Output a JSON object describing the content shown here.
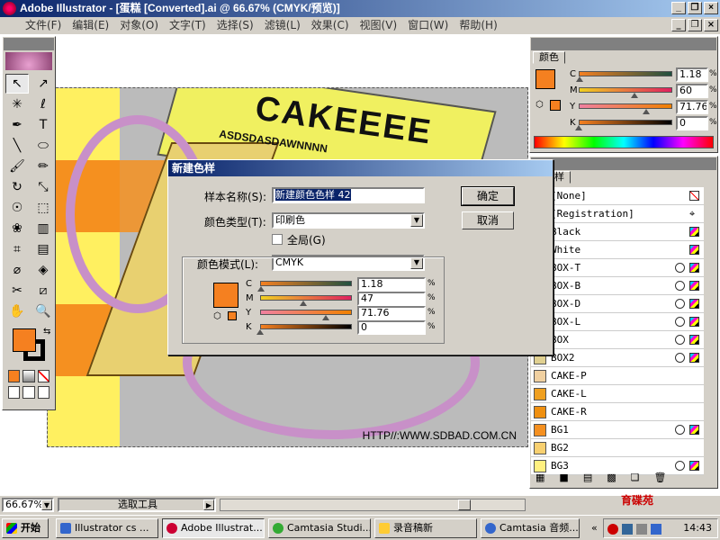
{
  "window": {
    "title": "Adobe Illustrator - [蛋糕 [Converted].ai @ 66.67% (CMYK/预览)]"
  },
  "menu": [
    "文件(F)",
    "编辑(E)",
    "对象(O)",
    "文字(T)",
    "选择(S)",
    "滤镜(L)",
    "效果(C)",
    "视图(V)",
    "窗口(W)",
    "帮助(H)"
  ],
  "winbtns": [
    "_",
    "❐",
    "×"
  ],
  "mdibtns": [
    "_",
    "❐",
    "×"
  ],
  "canvas": {
    "headline": "CAKEEEE",
    "subline": "ASDSDASDAWNNNN",
    "url": "HTTP//:WWW.SDBAD.COM.CN"
  },
  "dialog": {
    "title": "新建色样",
    "name_label": "样本名称(S):",
    "name_value": "新建颜色色样 42",
    "type_label": "颜色类型(T):",
    "type_value": "印刷色",
    "global_label": "全局(G)",
    "mode_label": "颜色模式(L):",
    "mode_value": "CMYK",
    "ok": "确定",
    "cancel": "取消",
    "channels": [
      {
        "label": "C",
        "value": "1.18",
        "pct": 1.18
      },
      {
        "label": "M",
        "value": "47",
        "pct": 47
      },
      {
        "label": "Y",
        "value": "71.76",
        "pct": 71.76
      },
      {
        "label": "K",
        "value": "0",
        "pct": 0
      }
    ],
    "unit": "%"
  },
  "color_panel": {
    "tab": "颜色",
    "channels": [
      {
        "label": "C",
        "value": "1.18",
        "pct": 1.18
      },
      {
        "label": "M",
        "value": "60",
        "pct": 60
      },
      {
        "label": "Y",
        "value": "71.76",
        "pct": 71.76
      },
      {
        "label": "K",
        "value": "0",
        "pct": 0
      }
    ]
  },
  "swatch_panel": {
    "tab": "样",
    "swatches": [
      {
        "name": "[None]",
        "color": "#ffffff"
      },
      {
        "name": "[Registration]",
        "color": "#000000"
      },
      {
        "name": "Black",
        "color": "#000000"
      },
      {
        "name": "White",
        "color": "#ffffff"
      },
      {
        "name": "BOX-T",
        "color": "#f0f060"
      },
      {
        "name": "BOX-B",
        "color": "#c0a040"
      },
      {
        "name": "BOX-D",
        "color": "#806020"
      },
      {
        "name": "BOX-L",
        "color": "#e0c060"
      },
      {
        "name": "BOX",
        "color": "#f0e080"
      },
      {
        "name": "BOX2",
        "color": "#e0d090"
      },
      {
        "name": "CAKE-P",
        "color": "#f0d0a0"
      },
      {
        "name": "CAKE-L",
        "color": "#f0a020"
      },
      {
        "name": "CAKE-R",
        "color": "#f09010"
      },
      {
        "name": "BG1",
        "color": "#f59020"
      },
      {
        "name": "BG2",
        "color": "#f8d070"
      },
      {
        "name": "BG3",
        "color": "#fff080"
      }
    ]
  },
  "status": {
    "zoom": "66.67%",
    "tool": "选取工具"
  },
  "taskbar": {
    "start": "开始",
    "tasks": [
      "Illustrator cs ...",
      "Adobe Illustrat...",
      "Camtasia Studi...",
      "录音稿新",
      "Camtasia 音频..."
    ],
    "clock": "14:43",
    "brand": "育碟苑"
  },
  "colors": {
    "accent": "#0a246a",
    "fill": "#f58020"
  }
}
